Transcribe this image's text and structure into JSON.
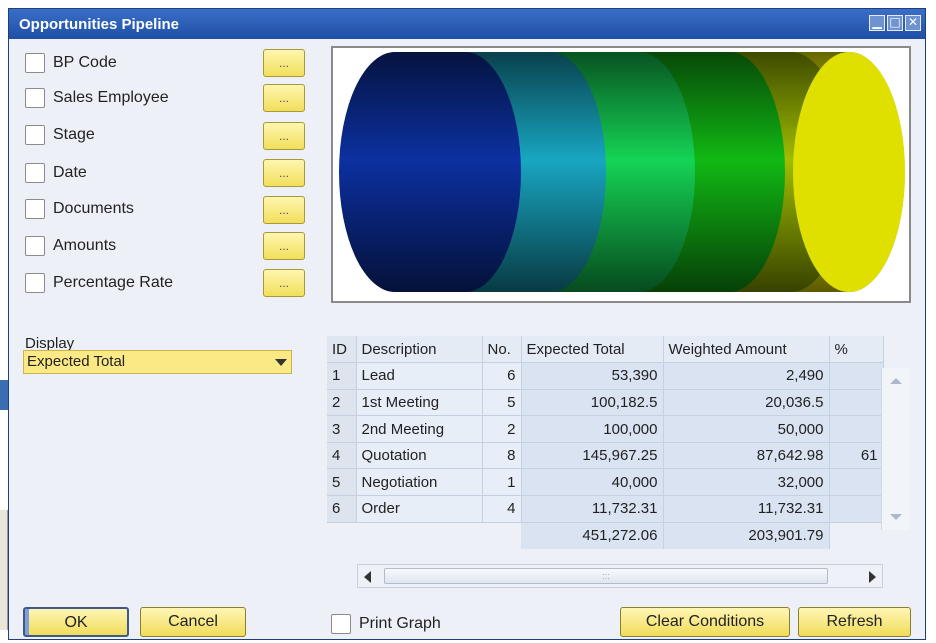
{
  "window": {
    "title": "Opportunities Pipeline",
    "minimize_glyph": "▁",
    "maximize_glyph": "□",
    "close_glyph": "✕"
  },
  "filters": [
    {
      "label": "BP Code",
      "button": "..."
    },
    {
      "label": "Sales Employee",
      "button": "..."
    },
    {
      "label": "Stage",
      "button": "..."
    },
    {
      "label": "Date",
      "button": "..."
    },
    {
      "label": "Documents",
      "button": "..."
    },
    {
      "label": "Amounts",
      "button": "..."
    },
    {
      "label": "Percentage Rate",
      "button": "..."
    }
  ],
  "display": {
    "label": "Display",
    "selected": "Expected Total"
  },
  "graph": {
    "type": "pipeline-cylinder",
    "segment_colors": [
      "#0a2a8c",
      "#1590a8",
      "#12b84a",
      "#0fa011",
      "#8aa400",
      "#e0e000"
    ]
  },
  "table": {
    "columns": [
      "ID",
      "Description",
      "No.",
      "Expected Total",
      "Weighted Amount",
      "%"
    ],
    "rows": [
      {
        "id": "1",
        "description": "Lead",
        "no": "6",
        "expected_total": "53,390",
        "weighted_amount": "2,490",
        "pct": ""
      },
      {
        "id": "2",
        "description": "1st Meeting",
        "no": "5",
        "expected_total": "100,182.5",
        "weighted_amount": "20,036.5",
        "pct": ""
      },
      {
        "id": "3",
        "description": "2nd Meeting",
        "no": "2",
        "expected_total": "100,000",
        "weighted_amount": "50,000",
        "pct": ""
      },
      {
        "id": "4",
        "description": "Quotation",
        "no": "8",
        "expected_total": "145,967.25",
        "weighted_amount": "87,642.98",
        "pct": "61"
      },
      {
        "id": "5",
        "description": "Negotiation",
        "no": "1",
        "expected_total": "40,000",
        "weighted_amount": "32,000",
        "pct": ""
      },
      {
        "id": "6",
        "description": "Order",
        "no": "4",
        "expected_total": "11,732.31",
        "weighted_amount": "11,732.31",
        "pct": ""
      }
    ],
    "totals": {
      "expected_total": "451,272.06",
      "weighted_amount": "203,901.79"
    },
    "hscroll_grip": ":::"
  },
  "buttons": {
    "ok": "OK",
    "cancel": "Cancel",
    "print_graph": "Print Graph",
    "clear_conditions": "Clear Conditions",
    "refresh": "Refresh"
  }
}
